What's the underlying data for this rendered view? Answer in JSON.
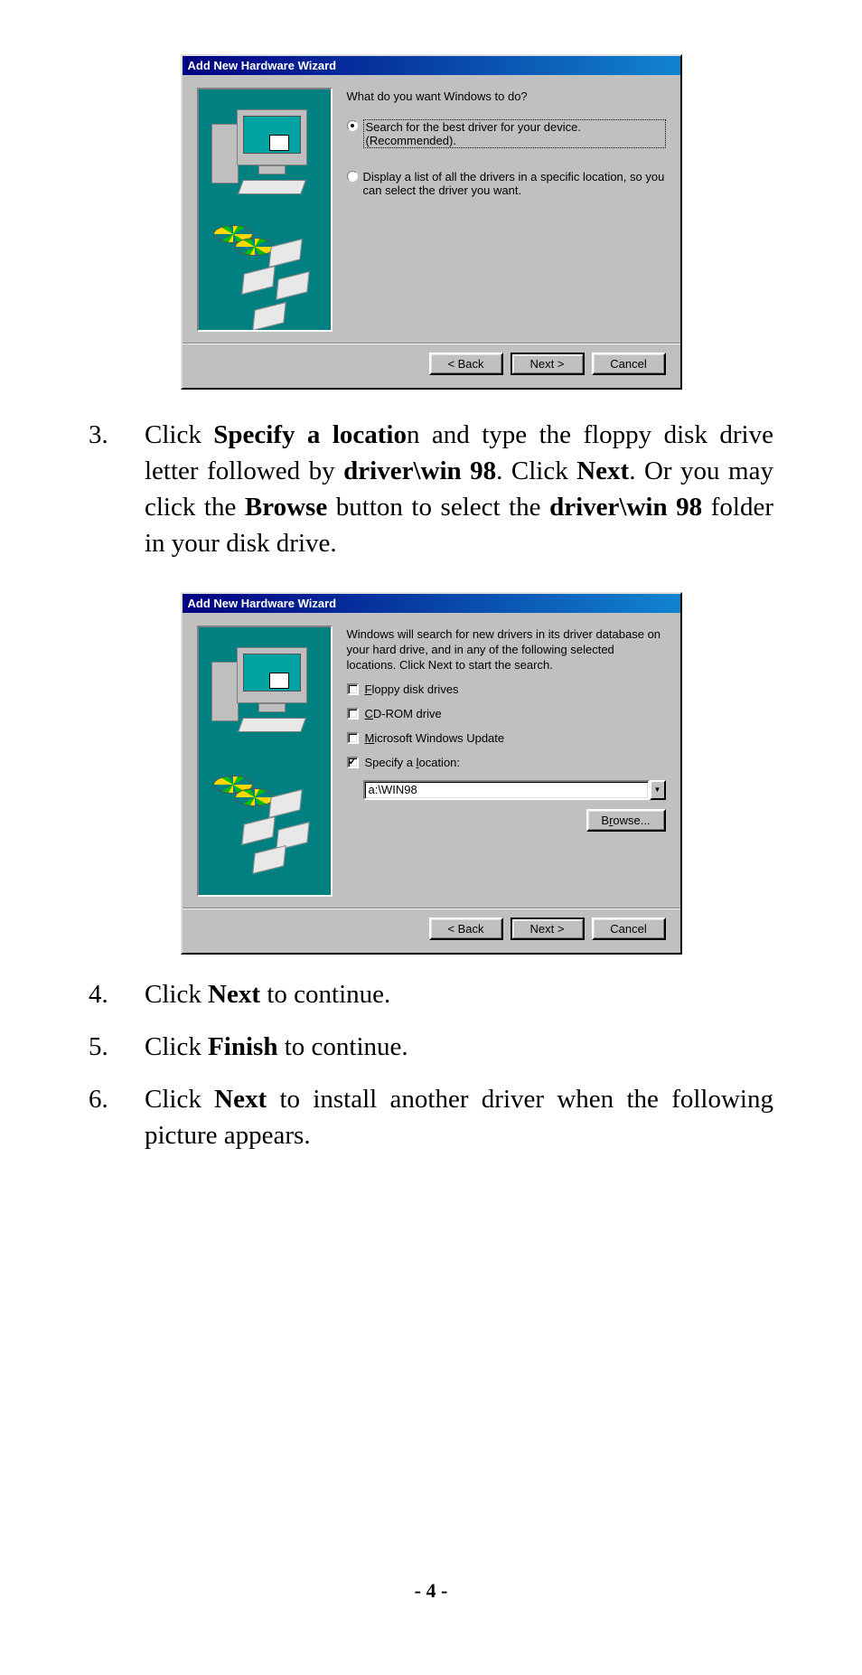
{
  "page_number_label": "- 4 -",
  "dialog1": {
    "title": "Add New Hardware Wizard",
    "prompt": "What do you want Windows to do?",
    "opt1": "Search for the best driver for your device. (Recommended).",
    "opt2": "Display a list of all the drivers in a specific location, so you can select the driver you want.",
    "buttons": {
      "back": "< Back",
      "next": "Next >",
      "cancel": "Cancel"
    }
  },
  "dialog2": {
    "title": "Add New Hardware Wizard",
    "intro": "Windows will search for new drivers in its driver database on your hard drive, and in any of the following selected locations. Click Next to start the search.",
    "check_floppy": "Floppy disk drives",
    "check_cdrom": "CD-ROM drive",
    "check_msupdate": "Microsoft Windows Update",
    "check_specify": "Specify a location:",
    "location_value": "a:\\WIN98",
    "browse_label": "Browse...",
    "buttons": {
      "back": "< Back",
      "next": "Next >",
      "cancel": "Cancel"
    }
  },
  "steps": {
    "s3_num": "3.",
    "s3_html": "Click <b>Specify a locatio</b>n and type the floppy disk drive letter followed by <b>driver\\win 98</b>. Click <b>Next</b>.  Or you may click the <b>Browse</b> button to select the <b>driver\\win 98</b> folder in your disk drive.",
    "s4_num": "4.",
    "s4_html": "Click <b>Next</b> to continue.",
    "s5_num": "5.",
    "s5_html": "Click <b>Finish</b> to continue.",
    "s6_num": "6.",
    "s6_html": "Click <b>Next</b> to install another driver when the following picture appears."
  }
}
